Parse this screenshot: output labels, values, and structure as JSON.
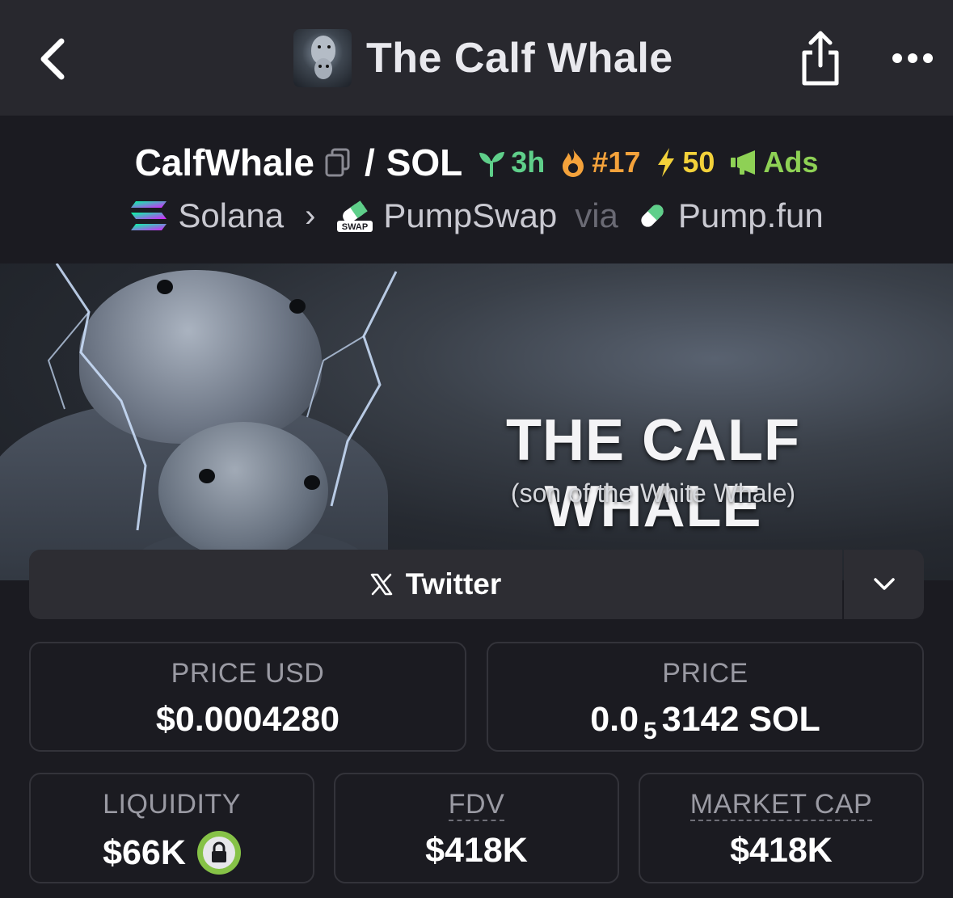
{
  "nav": {
    "title": "The Calf Whale",
    "back_icon": "chevron-left-icon",
    "share_icon": "share-icon",
    "more_icon": "more-horizontal-icon"
  },
  "pair": {
    "base": "CalfWhale",
    "separator": "/",
    "quote": "SOL",
    "age": "3h",
    "rank": "#17",
    "boosts": "50",
    "ads": "Ads",
    "colors": {
      "age": "#5fcf8a",
      "rank": "#f4a23b",
      "boosts": "#f2d13a",
      "ads": "#8ed155"
    }
  },
  "route": {
    "chain": "Solana",
    "dex": "PumpSwap",
    "dex_icon_text": "SWAP",
    "via": "via",
    "launchpad": "Pump.fun"
  },
  "banner": {
    "title": "THE CALF WHALE",
    "subtitle": "(son of the White Whale)"
  },
  "links": {
    "twitter_label": "Twitter"
  },
  "stats": {
    "price_usd": {
      "label": "PRICE USD",
      "value": "$0.0004280"
    },
    "price": {
      "label": "PRICE",
      "value_prefix": "0.0",
      "value_subscript": "5",
      "value_suffix": "3142 SOL"
    },
    "liquidity": {
      "label": "LIQUIDITY",
      "value": "$66K"
    },
    "fdv": {
      "label": "FDV",
      "value": "$418K"
    },
    "market_cap": {
      "label": "MARKET CAP",
      "value": "$418K"
    }
  }
}
